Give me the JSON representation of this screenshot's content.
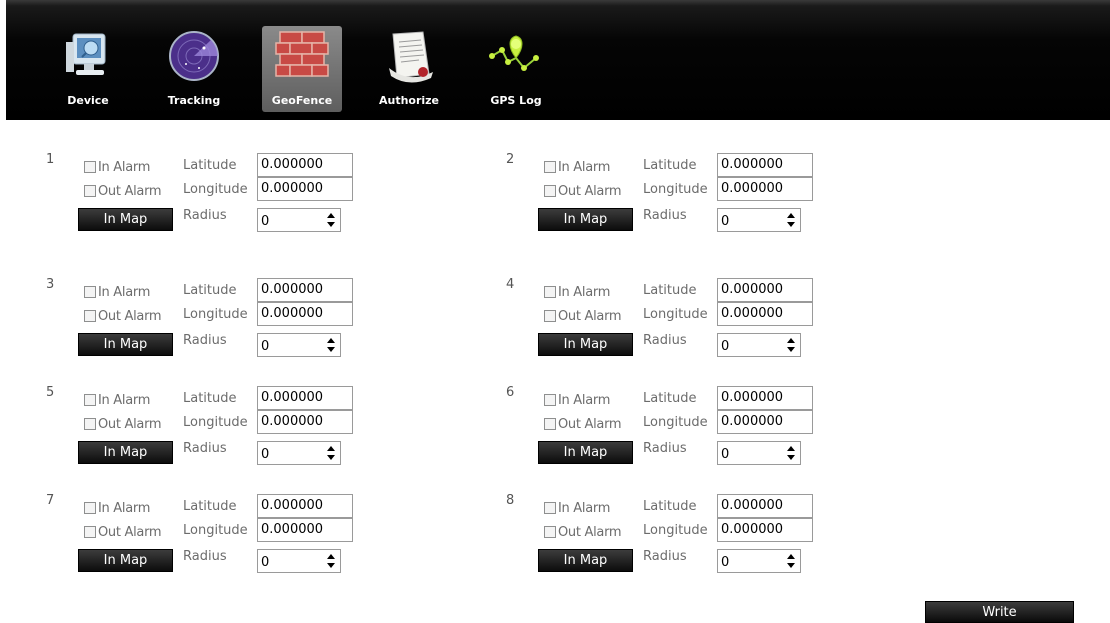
{
  "toolbar": {
    "items": [
      {
        "label": "Device",
        "icon": "device-monitor-icon",
        "active": false
      },
      {
        "label": "Tracking",
        "icon": "radar-icon",
        "active": false
      },
      {
        "label": "GeoFence",
        "icon": "brick-wall-icon",
        "active": true
      },
      {
        "label": "Authorize",
        "icon": "certificate-document-icon",
        "active": false
      },
      {
        "label": "GPS Log",
        "icon": "route-pin-icon",
        "active": false
      }
    ]
  },
  "form": {
    "in_alarm_label": "In Alarm",
    "out_alarm_label": "Out Alarm",
    "latitude_label": "Latitude",
    "longitude_label": "Longitude",
    "radius_label": "Radius",
    "in_map_label": "In Map"
  },
  "fences": [
    {
      "number": "1",
      "in_alarm": false,
      "out_alarm": false,
      "latitude": "0.000000",
      "longitude": "0.000000",
      "radius": "0"
    },
    {
      "number": "2",
      "in_alarm": false,
      "out_alarm": false,
      "latitude": "0.000000",
      "longitude": "0.000000",
      "radius": "0"
    },
    {
      "number": "3",
      "in_alarm": false,
      "out_alarm": false,
      "latitude": "0.000000",
      "longitude": "0.000000",
      "radius": "0"
    },
    {
      "number": "4",
      "in_alarm": false,
      "out_alarm": false,
      "latitude": "0.000000",
      "longitude": "0.000000",
      "radius": "0"
    },
    {
      "number": "5",
      "in_alarm": false,
      "out_alarm": false,
      "latitude": "0.000000",
      "longitude": "0.000000",
      "radius": "0"
    },
    {
      "number": "6",
      "in_alarm": false,
      "out_alarm": false,
      "latitude": "0.000000",
      "longitude": "0.000000",
      "radius": "0"
    },
    {
      "number": "7",
      "in_alarm": false,
      "out_alarm": false,
      "latitude": "0.000000",
      "longitude": "0.000000",
      "radius": "0"
    },
    {
      "number": "8",
      "in_alarm": false,
      "out_alarm": false,
      "latitude": "0.000000",
      "longitude": "0.000000",
      "radius": "0"
    }
  ],
  "write_button": {
    "label": "Write"
  }
}
